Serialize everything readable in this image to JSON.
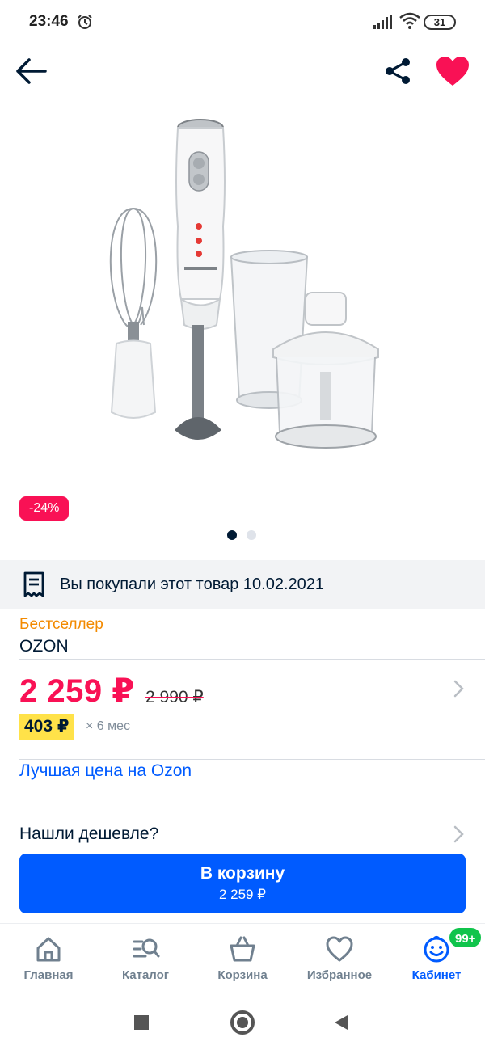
{
  "status_bar": {
    "time": "23:46",
    "battery": "31",
    "icons": [
      "alarm-icon",
      "signal-icon",
      "wifi-icon",
      "battery-icon"
    ]
  },
  "top_bar": {
    "icons": [
      "arrow-left-icon",
      "share-icon",
      "heart-icon"
    ],
    "favorite_color": "#f91155"
  },
  "gallery": {
    "discount": "-24%",
    "slides_total": 2,
    "active_slide": 1
  },
  "purchased_notice": {
    "text": "Вы покупали этот товар 10.02.2021",
    "icon": "receipt-icon"
  },
  "product": {
    "badge": "Бестселлер",
    "brand": "OZON"
  },
  "price": {
    "current": "2 259 ₽",
    "old": "2 990 ₽",
    "installment": "403 ₽",
    "installment_term": "× 6 мес"
  },
  "links": {
    "best_price": "Лучшая цена на Ozon",
    "found_cheaper": "Нашли дешевле?"
  },
  "cart_button": {
    "label": "В корзину",
    "price": "2 259 ₽"
  },
  "bottom_nav": {
    "items": [
      {
        "label": "Главная",
        "icon": "home-icon"
      },
      {
        "label": "Каталог",
        "icon": "catalog-search-icon"
      },
      {
        "label": "Корзина",
        "icon": "basket-icon"
      },
      {
        "label": "Избранное",
        "icon": "heart-outline-icon"
      },
      {
        "label": "Кабинет",
        "icon": "smile-profile-icon"
      }
    ],
    "active_index": 4,
    "cabinet_badge": "99+"
  },
  "colors": {
    "accent_blue": "#005bff",
    "price_pink": "#f91155",
    "bestseller_orange": "#f38a00",
    "installment_yellow": "#ffe249",
    "badge_green": "#10c44c"
  }
}
